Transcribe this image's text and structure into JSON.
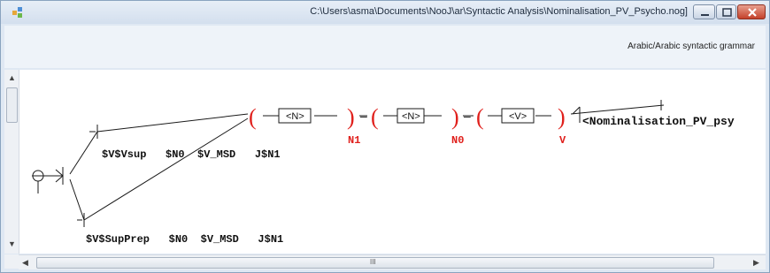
{
  "window": {
    "title": "C:\\Users\\asma\\Documents\\NooJ\\ar\\Syntactic Analysis\\Nominalisation_PV_Psycho.nog]",
    "grammar_label": "Arabic/Arabic syntactic grammar"
  },
  "graph": {
    "top_path": {
      "boxes": [
        "<N>",
        "<N>",
        "<V>"
      ],
      "variables": [
        "N1",
        "N0",
        "V"
      ],
      "output": "<Nominalisation_PV_psy",
      "subtitle": "$V$Vsup   $N0  $V_MSD   J$N1"
    },
    "bottom_path": {
      "subtitle": "$V$SupPrep   $N0  $V_MSD   J$N1"
    },
    "colors": {
      "variable": "#e0201c",
      "line": "#1a1a1a"
    }
  },
  "scrollbar": {
    "h_thumb_label": "III"
  }
}
